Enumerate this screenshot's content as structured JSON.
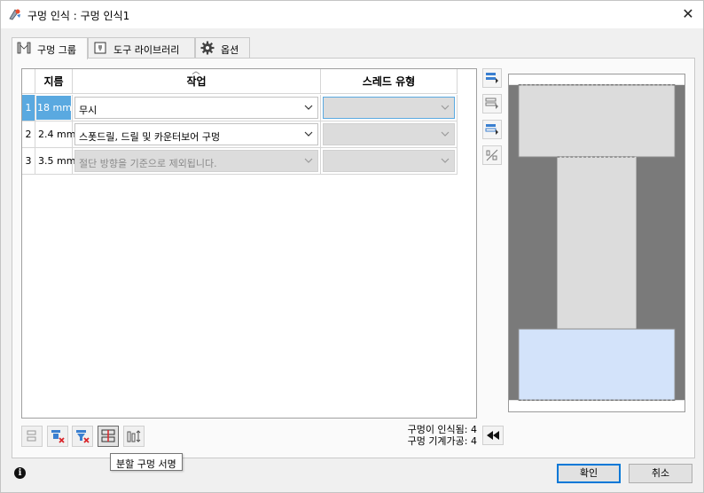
{
  "window": {
    "title": "구멍 인식 : 구멍 인식1",
    "close_icon": "close-icon"
  },
  "tabs": [
    {
      "label": "구멍 그룹",
      "icon": "hole-group-icon",
      "active": true
    },
    {
      "label": "도구 라이브러리",
      "icon": "tool-library-icon",
      "active": false
    },
    {
      "label": "옵션",
      "icon": "gear-icon",
      "active": false
    }
  ],
  "table": {
    "headers": {
      "diameter": "지름",
      "operation": "작업",
      "thread": "스레드 유형"
    },
    "rows": [
      {
        "index": "1",
        "diameter": "18 mm",
        "operation": "무시",
        "operation_enabled": true,
        "thread": "",
        "selected": true
      },
      {
        "index": "2",
        "diameter": "2.4 mm",
        "operation": "스폿드릴, 드릴 및 카운터보어 구멍",
        "operation_enabled": true,
        "thread": "",
        "selected": false
      },
      {
        "index": "3",
        "diameter": "3.5 mm",
        "operation": "절단 방향을 기준으로 제외됩니다.",
        "operation_enabled": false,
        "thread": "",
        "selected": false
      }
    ]
  },
  "side_toolbar": [
    "merge-rows-icon",
    "split-rows-icon",
    "move-rows-icon",
    "edit-dimensions-icon"
  ],
  "bottom_toolbar": [
    "row-layout-icon",
    "delete-filter-icon",
    "delete-funnel-icon",
    "split-hole-signature-icon",
    "bar-adjust-icon"
  ],
  "tooltip": "분할 구멍 서명",
  "status": {
    "recognized": "구멍이 인식됨: 4",
    "machinable": "구멍 기계가공: 4"
  },
  "buttons": {
    "ok": "확인",
    "cancel": "취소"
  },
  "colors": {
    "selection": "#5aa9e0",
    "preview_highlight": "#d3e3fa",
    "preview_body": "#7a7a7a",
    "primary_border": "#0078d7"
  }
}
